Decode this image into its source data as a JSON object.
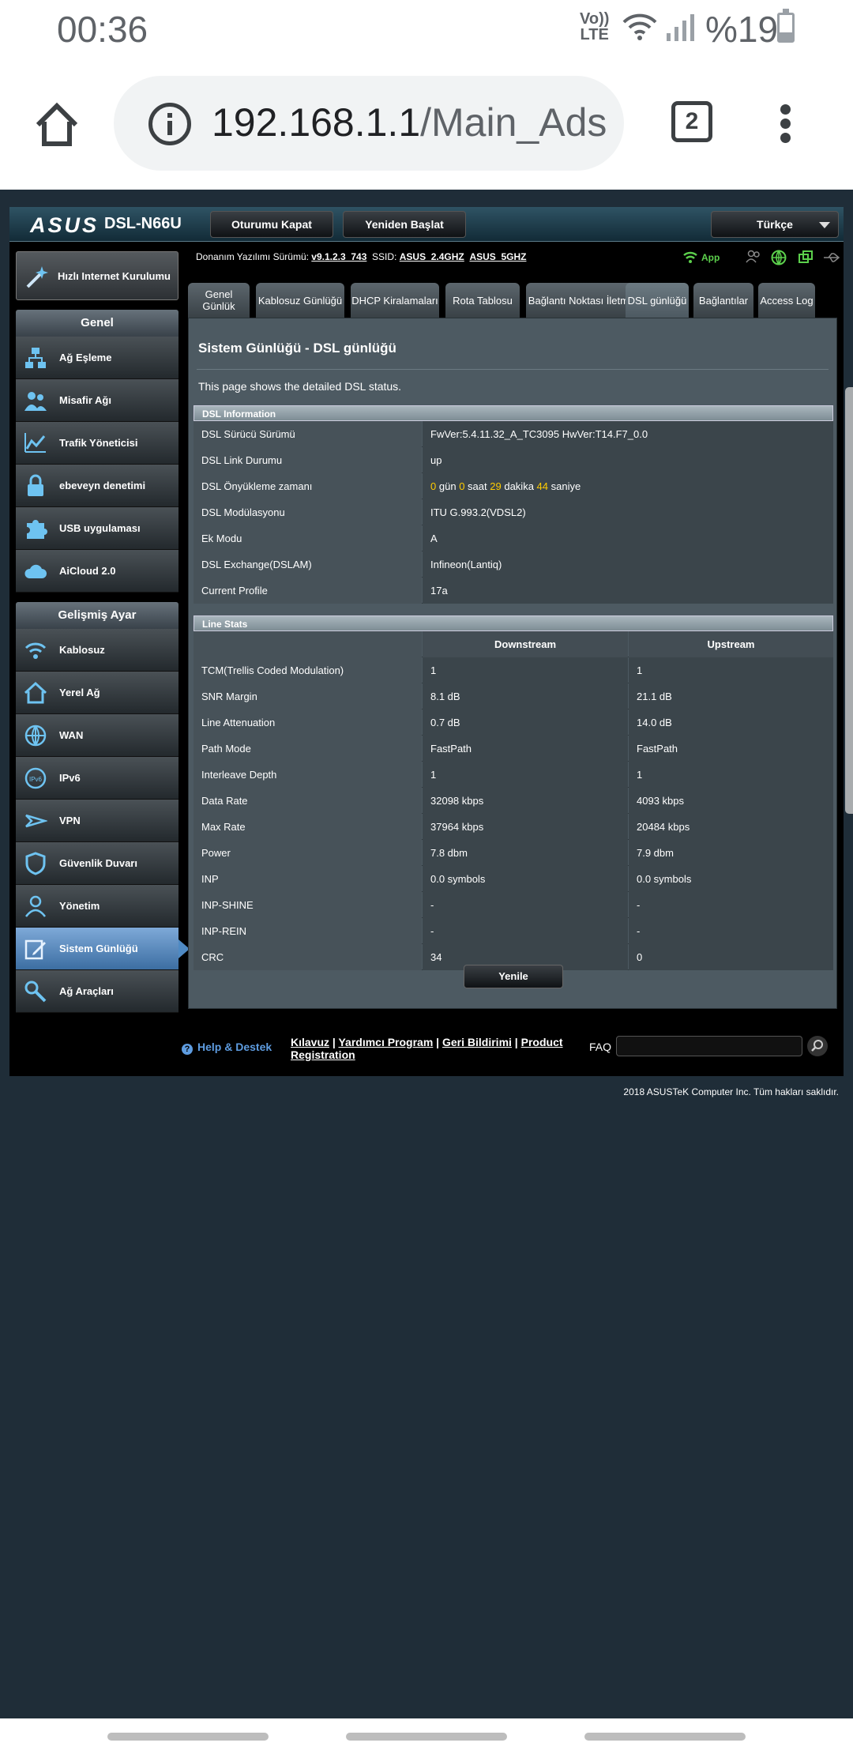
{
  "status": {
    "time": "00:36",
    "volte_top": "Vo))",
    "volte_bottom": "LTE",
    "battery": "%19"
  },
  "browser": {
    "url_host": "192.168.1.1",
    "url_path": "/Main_Ads",
    "tab_count": "2"
  },
  "router": {
    "brand": "ASUS",
    "model": "DSL-N66U",
    "logout": "Oturumu Kapat",
    "reboot": "Yeniden Başlat",
    "language": "Türkçe",
    "info": {
      "firmware_label": "Donanım Yazılımı Sürümü:",
      "firmware": "v9.1.2.3_743",
      "ssid_label": "SSID:",
      "ssid1": "ASUS_2.4GHZ",
      "ssid2": "ASUS_5GHZ",
      "app": "App"
    },
    "sidebar": {
      "quick": "Hızlı Internet Kurulumu",
      "general_title": "Genel",
      "general": [
        "Ağ Eşleme",
        "Misafir Ağı",
        "Trafik Yöneticisi",
        "ebeveyn denetimi",
        "USB uygulaması",
        "AiCloud 2.0"
      ],
      "advanced_title": "Gelişmiş Ayar",
      "advanced": [
        "Kablosuz",
        "Yerel Ağ",
        "WAN",
        "IPv6",
        "VPN",
        "Güvenlik Duvarı",
        "Yönetim",
        "Sistem Günlüğü",
        "Ağ Araçları"
      ]
    },
    "tabs": [
      "Genel Günlük",
      "Kablosuz Günlüğü",
      "DHCP Kiralamaları",
      "Rota Tablosu",
      "Bağlantı Noktası İletme",
      "DSL günlüğü",
      "Bağlantılar",
      "Access Log"
    ],
    "page_title": "Sistem Günlüğü - DSL günlüğü",
    "page_desc": "This page shows the detailed DSL status.",
    "dsl_info": {
      "title": "DSL Information",
      "rows": [
        {
          "label": "DSL Sürücü Sürümü",
          "value": "FwVer:5.4.11.32_A_TC3095 HwVer:T14.F7_0.0"
        },
        {
          "label": "DSL Link Durumu",
          "value": "up"
        },
        {
          "label": "DSL Önyükleme zamanı",
          "days": "0",
          "days_unit": "gün",
          "hours": "0",
          "hours_unit": "saat",
          "minutes": "29",
          "minutes_unit": "dakika",
          "seconds": "44",
          "seconds_unit": "saniye"
        },
        {
          "label": "DSL Modülasyonu",
          "value": "ITU G.993.2(VDSL2)"
        },
        {
          "label": "Ek Modu",
          "value": "A"
        },
        {
          "label": "DSL Exchange(DSLAM)",
          "value": "Infineon(Lantiq)"
        },
        {
          "label": "Current Profile",
          "value": "17a"
        }
      ]
    },
    "line_stats": {
      "title": "Line Stats",
      "down_header": "Downstream",
      "up_header": "Upstream",
      "rows": [
        {
          "label": "TCM(Trellis Coded Modulation)",
          "down": "1",
          "up": "1"
        },
        {
          "label": "SNR Margin",
          "down": "8.1 dB",
          "up": "21.1 dB"
        },
        {
          "label": "Line Attenuation",
          "down": "0.7 dB",
          "up": "14.0 dB"
        },
        {
          "label": "Path Mode",
          "down": "FastPath",
          "up": "FastPath"
        },
        {
          "label": "Interleave Depth",
          "down": "1",
          "up": "1"
        },
        {
          "label": "Data Rate",
          "down": "32098 kbps",
          "up": "4093 kbps"
        },
        {
          "label": "Max Rate",
          "down": "37964 kbps",
          "up": "20484 kbps"
        },
        {
          "label": "Power",
          "down": "7.8 dbm",
          "up": "7.9 dbm"
        },
        {
          "label": "INP",
          "down": "0.0 symbols",
          "up": "0.0 symbols"
        },
        {
          "label": "INP-SHINE",
          "down": "-",
          "up": "-"
        },
        {
          "label": "INP-REIN",
          "down": "-",
          "up": "-"
        },
        {
          "label": "CRC",
          "down": "34",
          "up": "0"
        }
      ]
    },
    "refresh": "Yenile",
    "footer": {
      "help": "Help & Destek",
      "manual": "Kılavuz",
      "utility": "Yardımcı Program",
      "feedback": "Geri Bildirimi",
      "reg": "Product Registration",
      "faq": "FAQ",
      "copyright": "2018 ASUSTeK Computer Inc. Tüm hakları saklıdır."
    }
  },
  "colors": {
    "accent": "#4f8ac3",
    "highlight": "#ffcc00",
    "app_green": "#5cd04c"
  }
}
